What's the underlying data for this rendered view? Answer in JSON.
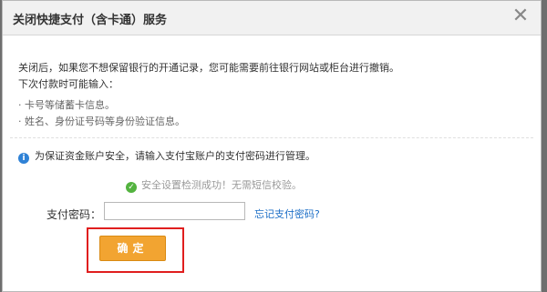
{
  "dialog": {
    "title": "关闭快捷支付（含卡通）服务",
    "close_glyph": "✕"
  },
  "content": {
    "line1": "关闭后，如果您不想保留银行的开通记录，您可能需要前往银行网站或柜台进行撤销。",
    "line2": "下次付款时可能输入：",
    "bullet1": "· 卡号等储蓄卡信息。",
    "bullet2": "· 姓名、身份证号码等身份验证信息。"
  },
  "notice": {
    "icon": "info-icon",
    "text": "为保证资金账户安全，请输入支付宝账户的支付密码进行管理。"
  },
  "security": {
    "icon": "check-icon",
    "text": "安全设置检测成功！无需短信校验。"
  },
  "password": {
    "label": "支付密码：",
    "value": "",
    "forgot_link": "忘记支付密码?"
  },
  "confirm": {
    "label": "确定"
  },
  "colors": {
    "accent": "#f2a431",
    "link": "#1d6fc7",
    "highlight": "#e01e1e",
    "success": "#53b33f",
    "info": "#2f82d6"
  }
}
